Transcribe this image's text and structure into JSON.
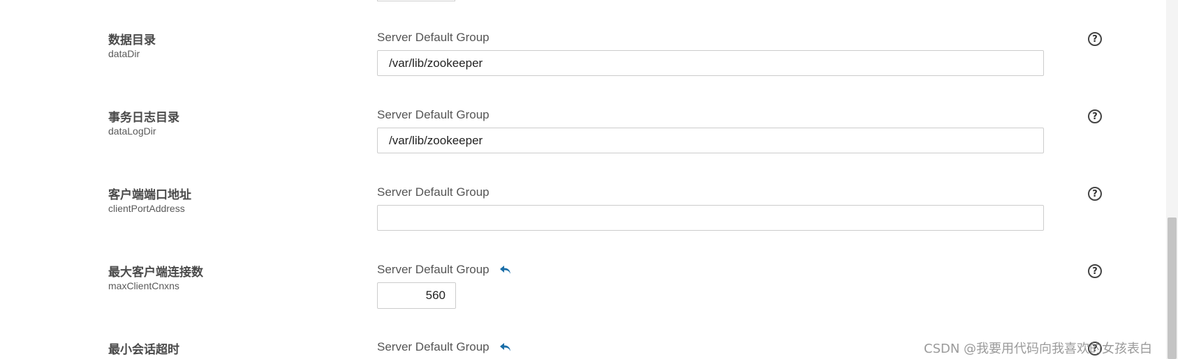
{
  "rows": [
    {
      "label_cn": "数据目录",
      "key": "dataDir",
      "group": "Server Default Group",
      "value": "/var/lib/zookeeper"
    },
    {
      "label_cn": "事务日志目录",
      "key": "dataLogDir",
      "group": "Server Default Group",
      "value": "/var/lib/zookeeper"
    },
    {
      "label_cn": "客户端端口地址",
      "key": "clientPortAddress",
      "group": "Server Default Group",
      "value": ""
    },
    {
      "label_cn": "最大客户端连接数",
      "key": "maxClientCnxns",
      "group": "Server Default Group",
      "value": "560"
    },
    {
      "label_cn": "最小会话超时",
      "key": "",
      "group": "Server Default Group",
      "value": ""
    }
  ],
  "icons": {
    "help": "help-circle-icon",
    "undo": "undo-arrow-icon"
  },
  "help_glyph": "?",
  "colors": {
    "accent": "#1a6ea8",
    "label": "#4a4a4a",
    "border": "#cccccc"
  },
  "watermark": "CSDN @我要用代码向我喜欢的女孩表白"
}
